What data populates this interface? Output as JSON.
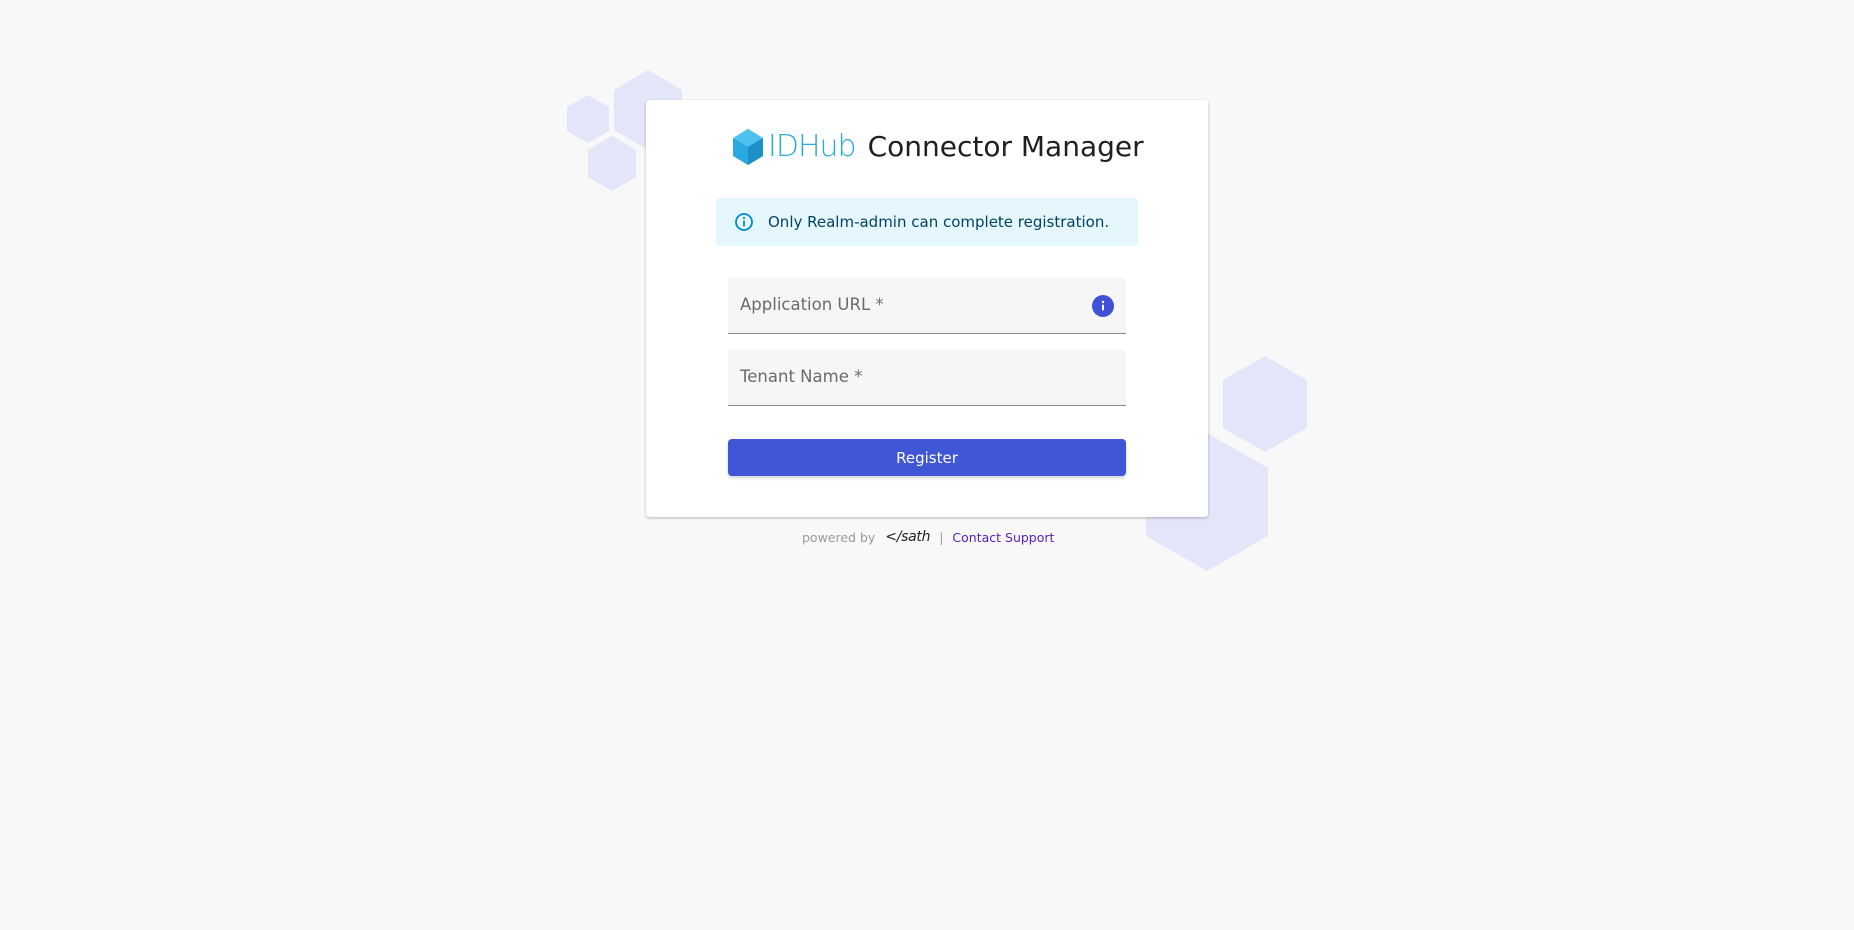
{
  "header": {
    "logo_text": "IDHub",
    "title": "Connector Manager"
  },
  "alert": {
    "icon": "info-circle-icon",
    "message": "Only Realm-admin can complete registration."
  },
  "form": {
    "application_url": {
      "label": "Application URL *",
      "value": "",
      "info_icon": "info-icon"
    },
    "tenant_name": {
      "label": "Tenant Name *",
      "value": ""
    },
    "register_label": "Register"
  },
  "footer": {
    "powered_by": "powered by",
    "logo_text": "</sath",
    "separator": "|",
    "contact_support": "Contact Support"
  },
  "colors": {
    "background": "#f8f8f8",
    "primary": "#3f56d6",
    "logo_blue": "#29a9e0",
    "alert_background": "#e5f6fd",
    "alert_text": "#014361",
    "hexagon": "#e3e5f9",
    "link": "#5b21b6"
  }
}
